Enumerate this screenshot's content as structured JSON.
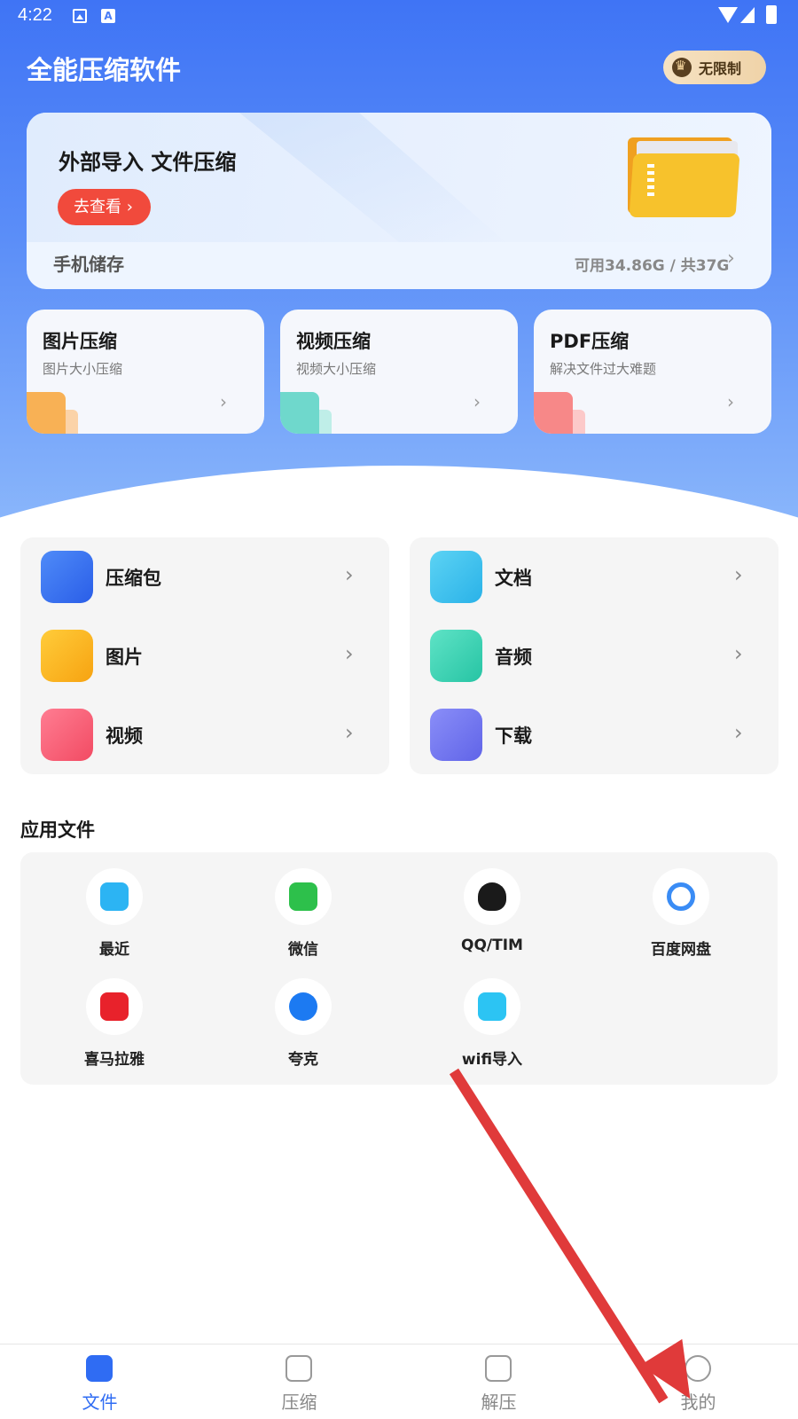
{
  "status_bar": {
    "time": "4:22",
    "a_icon_letter": "A"
  },
  "header": {
    "title": "全能压缩软件",
    "vip_label": "无限制"
  },
  "banner": {
    "title": "外部导入 文件压缩",
    "button_label": "去查看",
    "storage_label": "手机储存",
    "storage_info": "可用34.86G / 共37G"
  },
  "compress_cards": [
    {
      "title": "图片压缩",
      "subtitle": "图片大小压缩"
    },
    {
      "title": "视频压缩",
      "subtitle": "视频大小压缩"
    },
    {
      "title": "PDF压缩",
      "subtitle": "解决文件过大难题"
    }
  ],
  "categories": {
    "left": [
      {
        "label": "压缩包",
        "icon": "archive-icon"
      },
      {
        "label": "图片",
        "icon": "image-icon"
      },
      {
        "label": "视频",
        "icon": "video-icon"
      }
    ],
    "right": [
      {
        "label": "文档",
        "icon": "document-icon"
      },
      {
        "label": "音频",
        "icon": "audio-icon"
      },
      {
        "label": "下载",
        "icon": "download-icon"
      }
    ]
  },
  "apps_section": {
    "title": "应用文件",
    "apps": [
      {
        "label": "最近",
        "icon": "recent-folder-icon"
      },
      {
        "label": "微信",
        "icon": "wechat-icon"
      },
      {
        "label": "QQ/TIM",
        "icon": "qq-icon"
      },
      {
        "label": "百度网盘",
        "icon": "baidu-netdisk-icon"
      },
      {
        "label": "喜马拉雅",
        "icon": "ximalaya-icon"
      },
      {
        "label": "夸克",
        "icon": "quark-icon"
      },
      {
        "label": "wifi导入",
        "icon": "wifi-icon"
      }
    ]
  },
  "bottom_nav": {
    "items": [
      {
        "label": "文件",
        "active": true
      },
      {
        "label": "压缩",
        "active": false
      },
      {
        "label": "解压",
        "active": false
      },
      {
        "label": "我的",
        "active": false
      }
    ]
  },
  "colors": {
    "primary_blue": "#3f74f5",
    "banner_button": "#f14a3c",
    "annotation_arrow": "#e03a3a"
  }
}
